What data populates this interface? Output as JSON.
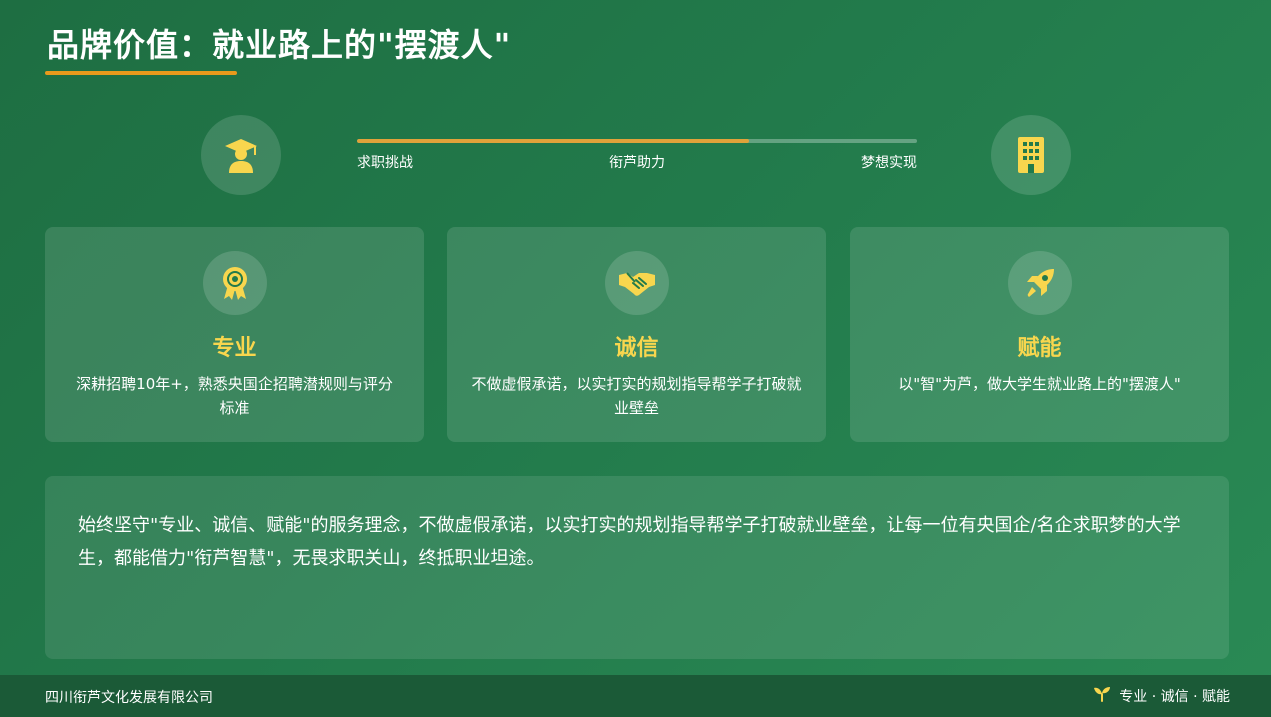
{
  "header": {
    "title": "品牌价值：就业路上的\"摆渡人\""
  },
  "journey": {
    "start_icon": "graduate-icon",
    "end_icon": "building-icon",
    "progress_fraction": 0.7,
    "stages": [
      "求职挑战",
      "衔芦助力",
      "梦想实现"
    ]
  },
  "cards": [
    {
      "icon": "award-icon",
      "title": "专业",
      "desc": "深耕招聘10年+，熟悉央国企招聘潜规则与评分标准"
    },
    {
      "icon": "handshake-icon",
      "title": "诚信",
      "desc": "不做虚假承诺，以实打实的规划指导帮学子打破就业壁垒"
    },
    {
      "icon": "rocket-icon",
      "title": "赋能",
      "desc": "以\"智\"为芦，做大学生就业路上的\"摆渡人\""
    }
  ],
  "statement": {
    "text": "始终坚守\"专业、诚信、赋能\"的服务理念，不做虚假承诺，以实打实的规划指导帮学子打破就业壁垒，让每一位有央国企/名企求职梦的大学生，都能借力\"衔芦智慧\"，无畏求职关山，终抵职业坦途。"
  },
  "footer": {
    "company": "四川衔芦文化发展有限公司",
    "icon": "sprout-icon",
    "slogan": "专业 · 诚信 · 赋能"
  },
  "colors": {
    "accent_gold": "#f8d64e",
    "underline_orange": "#e89a1c",
    "progress_fill": "#e0a23a",
    "background_green": "#227a4b"
  }
}
